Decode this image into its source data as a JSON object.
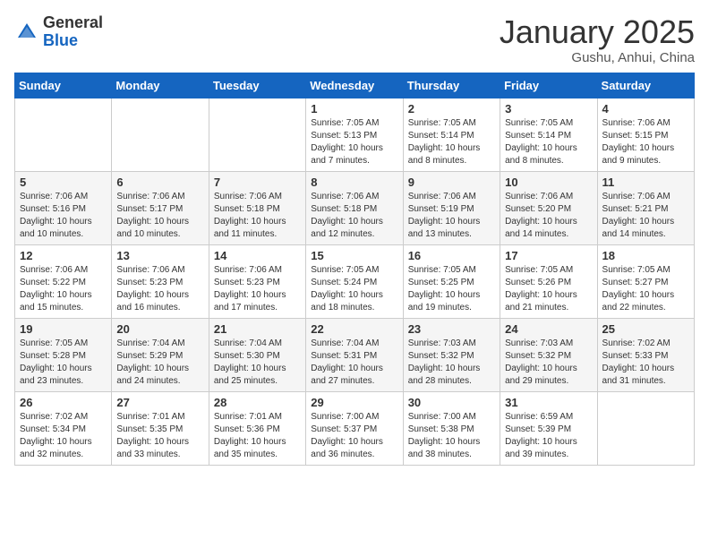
{
  "logo": {
    "general": "General",
    "blue": "Blue"
  },
  "title": "January 2025",
  "subtitle": "Gushu, Anhui, China",
  "days_header": [
    "Sunday",
    "Monday",
    "Tuesday",
    "Wednesday",
    "Thursday",
    "Friday",
    "Saturday"
  ],
  "weeks": [
    [
      {
        "day": "",
        "info": ""
      },
      {
        "day": "",
        "info": ""
      },
      {
        "day": "",
        "info": ""
      },
      {
        "day": "1",
        "info": "Sunrise: 7:05 AM\nSunset: 5:13 PM\nDaylight: 10 hours\nand 7 minutes."
      },
      {
        "day": "2",
        "info": "Sunrise: 7:05 AM\nSunset: 5:14 PM\nDaylight: 10 hours\nand 8 minutes."
      },
      {
        "day": "3",
        "info": "Sunrise: 7:05 AM\nSunset: 5:14 PM\nDaylight: 10 hours\nand 8 minutes."
      },
      {
        "day": "4",
        "info": "Sunrise: 7:06 AM\nSunset: 5:15 PM\nDaylight: 10 hours\nand 9 minutes."
      }
    ],
    [
      {
        "day": "5",
        "info": "Sunrise: 7:06 AM\nSunset: 5:16 PM\nDaylight: 10 hours\nand 10 minutes."
      },
      {
        "day": "6",
        "info": "Sunrise: 7:06 AM\nSunset: 5:17 PM\nDaylight: 10 hours\nand 10 minutes."
      },
      {
        "day": "7",
        "info": "Sunrise: 7:06 AM\nSunset: 5:18 PM\nDaylight: 10 hours\nand 11 minutes."
      },
      {
        "day": "8",
        "info": "Sunrise: 7:06 AM\nSunset: 5:18 PM\nDaylight: 10 hours\nand 12 minutes."
      },
      {
        "day": "9",
        "info": "Sunrise: 7:06 AM\nSunset: 5:19 PM\nDaylight: 10 hours\nand 13 minutes."
      },
      {
        "day": "10",
        "info": "Sunrise: 7:06 AM\nSunset: 5:20 PM\nDaylight: 10 hours\nand 14 minutes."
      },
      {
        "day": "11",
        "info": "Sunrise: 7:06 AM\nSunset: 5:21 PM\nDaylight: 10 hours\nand 14 minutes."
      }
    ],
    [
      {
        "day": "12",
        "info": "Sunrise: 7:06 AM\nSunset: 5:22 PM\nDaylight: 10 hours\nand 15 minutes."
      },
      {
        "day": "13",
        "info": "Sunrise: 7:06 AM\nSunset: 5:23 PM\nDaylight: 10 hours\nand 16 minutes."
      },
      {
        "day": "14",
        "info": "Sunrise: 7:06 AM\nSunset: 5:23 PM\nDaylight: 10 hours\nand 17 minutes."
      },
      {
        "day": "15",
        "info": "Sunrise: 7:05 AM\nSunset: 5:24 PM\nDaylight: 10 hours\nand 18 minutes."
      },
      {
        "day": "16",
        "info": "Sunrise: 7:05 AM\nSunset: 5:25 PM\nDaylight: 10 hours\nand 19 minutes."
      },
      {
        "day": "17",
        "info": "Sunrise: 7:05 AM\nSunset: 5:26 PM\nDaylight: 10 hours\nand 21 minutes."
      },
      {
        "day": "18",
        "info": "Sunrise: 7:05 AM\nSunset: 5:27 PM\nDaylight: 10 hours\nand 22 minutes."
      }
    ],
    [
      {
        "day": "19",
        "info": "Sunrise: 7:05 AM\nSunset: 5:28 PM\nDaylight: 10 hours\nand 23 minutes."
      },
      {
        "day": "20",
        "info": "Sunrise: 7:04 AM\nSunset: 5:29 PM\nDaylight: 10 hours\nand 24 minutes."
      },
      {
        "day": "21",
        "info": "Sunrise: 7:04 AM\nSunset: 5:30 PM\nDaylight: 10 hours\nand 25 minutes."
      },
      {
        "day": "22",
        "info": "Sunrise: 7:04 AM\nSunset: 5:31 PM\nDaylight: 10 hours\nand 27 minutes."
      },
      {
        "day": "23",
        "info": "Sunrise: 7:03 AM\nSunset: 5:32 PM\nDaylight: 10 hours\nand 28 minutes."
      },
      {
        "day": "24",
        "info": "Sunrise: 7:03 AM\nSunset: 5:32 PM\nDaylight: 10 hours\nand 29 minutes."
      },
      {
        "day": "25",
        "info": "Sunrise: 7:02 AM\nSunset: 5:33 PM\nDaylight: 10 hours\nand 31 minutes."
      }
    ],
    [
      {
        "day": "26",
        "info": "Sunrise: 7:02 AM\nSunset: 5:34 PM\nDaylight: 10 hours\nand 32 minutes."
      },
      {
        "day": "27",
        "info": "Sunrise: 7:01 AM\nSunset: 5:35 PM\nDaylight: 10 hours\nand 33 minutes."
      },
      {
        "day": "28",
        "info": "Sunrise: 7:01 AM\nSunset: 5:36 PM\nDaylight: 10 hours\nand 35 minutes."
      },
      {
        "day": "29",
        "info": "Sunrise: 7:00 AM\nSunset: 5:37 PM\nDaylight: 10 hours\nand 36 minutes."
      },
      {
        "day": "30",
        "info": "Sunrise: 7:00 AM\nSunset: 5:38 PM\nDaylight: 10 hours\nand 38 minutes."
      },
      {
        "day": "31",
        "info": "Sunrise: 6:59 AM\nSunset: 5:39 PM\nDaylight: 10 hours\nand 39 minutes."
      },
      {
        "day": "",
        "info": ""
      }
    ]
  ]
}
